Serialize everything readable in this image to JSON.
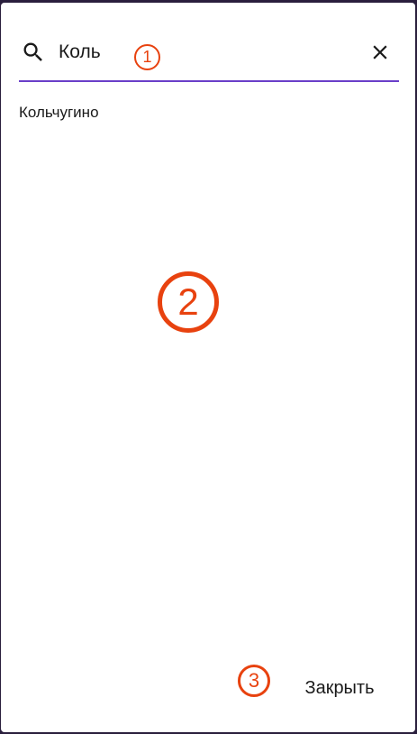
{
  "search": {
    "value": "Коль",
    "icon": "search-icon",
    "clear_icon": "close-icon",
    "underline_color": "#6a3fc9"
  },
  "results": [
    {
      "label": "Кольчугино"
    }
  ],
  "footer": {
    "close_label": "Закрыть"
  },
  "annotations": {
    "color": "#e8420f",
    "markers": [
      "1",
      "2",
      "3"
    ]
  }
}
